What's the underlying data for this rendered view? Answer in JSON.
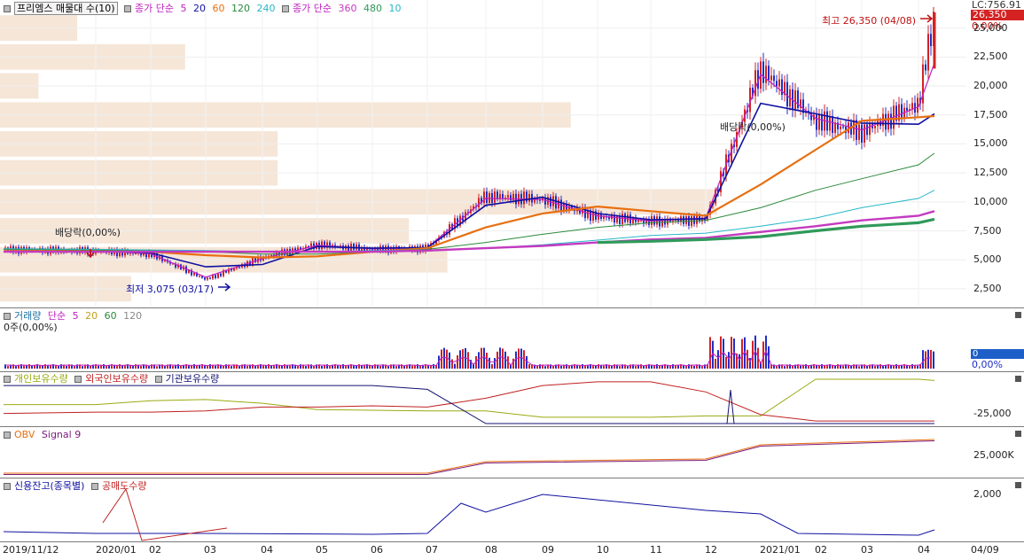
{
  "chart_title": "프리엠스 매물대 수(10)",
  "price_ma_legend": {
    "label": "종가 단순",
    "periods": [
      "5",
      "20",
      "60",
      "120",
      "240"
    ]
  },
  "price_ma_legend2": {
    "label": "종가 단순",
    "periods": [
      "360",
      "480",
      "10"
    ]
  },
  "volume_legend": {
    "label": "거래량",
    "ma_label": "단순",
    "periods": [
      "5",
      "20",
      "60",
      "120"
    ],
    "sub": "0주(0,00%)"
  },
  "holders_legend": [
    "개인보유수량",
    "외국인보유수량",
    "기관보유수량"
  ],
  "obv_legend": [
    "OBV",
    "Signal 9"
  ],
  "credit_legend": [
    "신용잔고(종목별)",
    "공매도수량"
  ],
  "price_axis": {
    "ticks": [
      "2,500",
      "5,000",
      "7,500",
      "10,000",
      "12,500",
      "15,000",
      "17,500",
      "20,000",
      "22,500",
      "25,000"
    ],
    "top_label": "LC:756.91",
    "current": "26,350",
    "pct": "0,00%"
  },
  "volume_axis": {
    "current": "0",
    "pct": "0,00%"
  },
  "holders_axis": {
    "tick": "-25,000"
  },
  "obv_axis": {
    "tick": "25,000K"
  },
  "credit_axis": {
    "tick": "2,000"
  },
  "x_axis_labels": [
    "2019/11/12",
    "2020/01",
    "02",
    "03",
    "04",
    "05",
    "06",
    "07",
    "08",
    "09",
    "10",
    "11",
    "12",
    "2021/01",
    "02",
    "03",
    "04",
    "04/09"
  ],
  "annotations": {
    "high": "최고 26,350 (04/08)",
    "low": "최저 3,075 (03/17)",
    "div1": "배당락(0,00%)",
    "div2": "배당락(0,00%)"
  },
  "colors": {
    "up": "#d42222",
    "down": "#1d2fc8",
    "ma5": "#c020c0",
    "ma20": "#1010a0",
    "ma60": "#e86f10",
    "ma120": "#2a8a3a",
    "ma240": "#26b8c8",
    "ma360": "#c33ac0",
    "ma480": "#2f9a5a",
    "profile": "#f5e6d8",
    "personal": "#9aaa10",
    "foreign": "#c02020",
    "institution": "#121270"
  },
  "chart_data": {
    "type": "line",
    "title": "프리엠스 매물대 수(10)",
    "x": [
      "2019/11/12",
      "2020/01",
      "2020/02",
      "2020/03",
      "2020/04",
      "2020/05",
      "2020/06",
      "2020/07",
      "2020/08",
      "2020/09",
      "2020/10",
      "2020/11",
      "2020/12",
      "2021/01",
      "2021/02",
      "2021/03",
      "2021/04",
      "2021/04/09"
    ],
    "ylim": [
      1500,
      26500
    ],
    "series": [
      {
        "name": "종가",
        "values": [
          5900,
          5750,
          5500,
          3300,
          5200,
          6300,
          5900,
          6000,
          10500,
          10200,
          8700,
          8300,
          8500,
          21500,
          17000,
          16000,
          18500,
          26350
        ]
      },
      {
        "name": "5",
        "values": [
          5900,
          5780,
          5520,
          3500,
          5100,
          6250,
          5950,
          6050,
          10300,
          10200,
          8800,
          8350,
          8600,
          21000,
          17200,
          16200,
          18200,
          22000
        ]
      },
      {
        "name": "20",
        "values": [
          5900,
          5800,
          5600,
          4400,
          4600,
          6150,
          6000,
          6050,
          9700,
          10400,
          9000,
          8450,
          8550,
          18500,
          17600,
          16800,
          16700,
          17600
        ]
      },
      {
        "name": "60",
        "values": [
          5900,
          5800,
          5700,
          5400,
          5200,
          5300,
          5700,
          6000,
          7800,
          9000,
          9600,
          9200,
          8800,
          11500,
          14500,
          17000,
          17300,
          17400
        ]
      },
      {
        "name": "120",
        "values": [
          5900,
          5850,
          5800,
          5700,
          5500,
          5500,
          5700,
          5900,
          6500,
          7200,
          7800,
          8200,
          8400,
          9500,
          11000,
          12000,
          13200,
          14200
        ]
      },
      {
        "name": "240",
        "values": [
          5950,
          5900,
          5850,
          5800,
          5700,
          5700,
          5800,
          5850,
          6000,
          6300,
          6700,
          7100,
          7300,
          7900,
          8600,
          9500,
          10300,
          11000
        ]
      },
      {
        "name": "360",
        "values": [
          5700,
          5700,
          5700,
          5700,
          5700,
          5700,
          5700,
          5800,
          6000,
          6200,
          6500,
          6750,
          6900,
          7400,
          7900,
          8400,
          8800,
          9200
        ]
      },
      {
        "name": "480",
        "values": [
          null,
          null,
          null,
          null,
          null,
          null,
          null,
          null,
          null,
          null,
          6500,
          6600,
          6750,
          7000,
          7500,
          7900,
          8200,
          8500
        ]
      }
    ],
    "volume_profile": {
      "type": "bar",
      "price_levels": [
        2500,
        5000,
        7500,
        10000,
        12500,
        15000,
        17500,
        20000,
        22500,
        25000
      ],
      "relative": [
        0.17,
        0.58,
        0.53,
        0.93,
        0.36,
        0.36,
        0.74,
        0.05,
        0.24,
        0.1
      ]
    },
    "holders": {
      "type": "line",
      "series": [
        {
          "name": "개인보유수량",
          "values": [
            -15000,
            -15000,
            -12000,
            -11000,
            -14000,
            -19000,
            -19500,
            -20000,
            -20000,
            -25000,
            -25000,
            -25000,
            -24000,
            -24000,
            5000,
            5000,
            5000,
            4000
          ]
        },
        {
          "name": "외국인보유수량",
          "values": [
            -22000,
            -21000,
            -21000,
            -20000,
            -17000,
            -17000,
            -16000,
            -17000,
            -10000,
            0,
            3000,
            3000,
            -5000,
            -23000,
            -28000,
            -28000,
            -28000,
            -28000
          ]
        },
        {
          "name": "기관보유수량",
          "values": [
            0,
            0,
            0,
            0,
            0,
            0,
            0,
            -3000,
            -30000,
            -30000,
            -30000,
            -30000,
            -30000,
            -30000,
            -30000,
            -30000,
            -30000,
            -30000
          ]
        }
      ]
    }
  }
}
